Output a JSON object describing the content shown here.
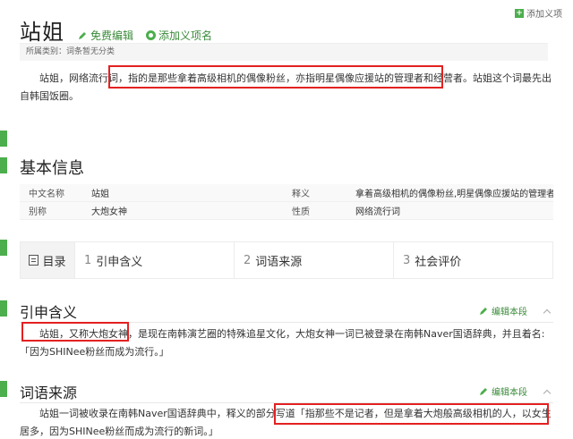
{
  "top_right": {
    "add_label": "添加义项"
  },
  "header": {
    "title": "站姐",
    "edit_label": "免费编辑",
    "add_name_label": "添加义项名"
  },
  "category": "所属类别：词条暂无分类",
  "intro": "站姐，网络流行词，指的是那些拿着高级相机的偶像粉丝，亦指明星偶像应援站的管理者和经营者。站姐这个词最先出自韩国饭圈。",
  "basic_info": {
    "title": "基本信息",
    "rows": [
      {
        "k1": "中文名称",
        "v1": "站姐",
        "k2": "释义",
        "v2": "拿着高级相机的偶像粉丝,明星偶像应援站的管理者和经"
      },
      {
        "k1": "别称",
        "v1": "大炮女神",
        "k2": "性质",
        "v2": "网络流行词"
      }
    ]
  },
  "toc": {
    "head": "目录",
    "items": [
      {
        "num": "1",
        "label": "引申含义"
      },
      {
        "num": "2",
        "label": "词语来源"
      },
      {
        "num": "3",
        "label": "社会评价"
      }
    ]
  },
  "sections": [
    {
      "title": "引申含义",
      "edit_label": "编辑本段",
      "text": "站姐，又称大炮女神，是现在南韩演艺圈的特殊追星文化，大炮女神一词已被登录在南韩Naver国语辞典，并且着名:「因为SHINee粉丝而成为流行。」"
    },
    {
      "title": "词语来源",
      "edit_label": "编辑本段",
      "text": "站姐一词被收录在南韩Naver国语辞典中，释义的部分写道「指那些不是记者，但是拿着大炮般高级相机的人，以女生居多，因为SHINee粉丝而成为流行的新词。」"
    }
  ],
  "colors": {
    "accent": "#4cae4c",
    "highlight": "#e32121"
  }
}
